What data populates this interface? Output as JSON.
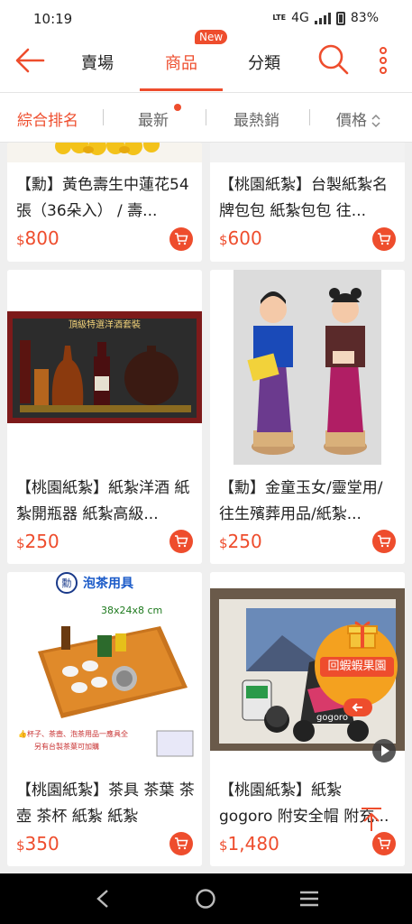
{
  "status": {
    "time": "10:19",
    "network": "4G",
    "lte_label": "LTE",
    "battery": "83%"
  },
  "topnav": {
    "tabs": [
      {
        "label": "賣場"
      },
      {
        "label": "商品"
      },
      {
        "label": "分類"
      }
    ],
    "new_badge": "New",
    "active_tab": "商品"
  },
  "sortbar": {
    "items": [
      {
        "label": "綜合排名"
      },
      {
        "label": "最新"
      },
      {
        "label": "最熱銷"
      },
      {
        "label": "價格"
      }
    ],
    "active": "綜合排名"
  },
  "products": [
    {
      "title": "【勳】黃色壽生中蓮花54張（36朵入） / 壽...",
      "currency": "$",
      "price": "800"
    },
    {
      "title": "【桃園紙紮】台製紙紮名牌包包 紙紮包包 往...",
      "currency": "$",
      "price": "600"
    },
    {
      "title": "【桃園紙紮】紙紮洋酒 紙紮開瓶器 紙紮高級...",
      "currency": "$",
      "price": "250",
      "image_text": "頂級特選洋酒套裝"
    },
    {
      "title": "【勳】金童玉女/靈堂用/往生殯葬用品/紙紮...",
      "currency": "$",
      "price": "250"
    },
    {
      "title": "【桃園紙紮】茶具 茶葉 茶壺 茶杯 紙紮 紙紮",
      "currency": "$",
      "price": "350",
      "image_text": {
        "logo": "勳",
        "heading": "泡茶用具",
        "size": "38x24x8 cm",
        "note1": "👍杯子、茶壺、泡茶用品一應具全",
        "note2": "另有台製茶葉可加購"
      }
    },
    {
      "title": "【桃園紙紮】紙紮 gogoro 附安全帽 附充...",
      "currency": "$",
      "price": "1,480",
      "image_text": "gogoro"
    }
  ],
  "fab": {
    "label": "回蝦蝦果園"
  },
  "colors": {
    "accent": "#ee4d2d",
    "fab": "#f4a11f"
  }
}
